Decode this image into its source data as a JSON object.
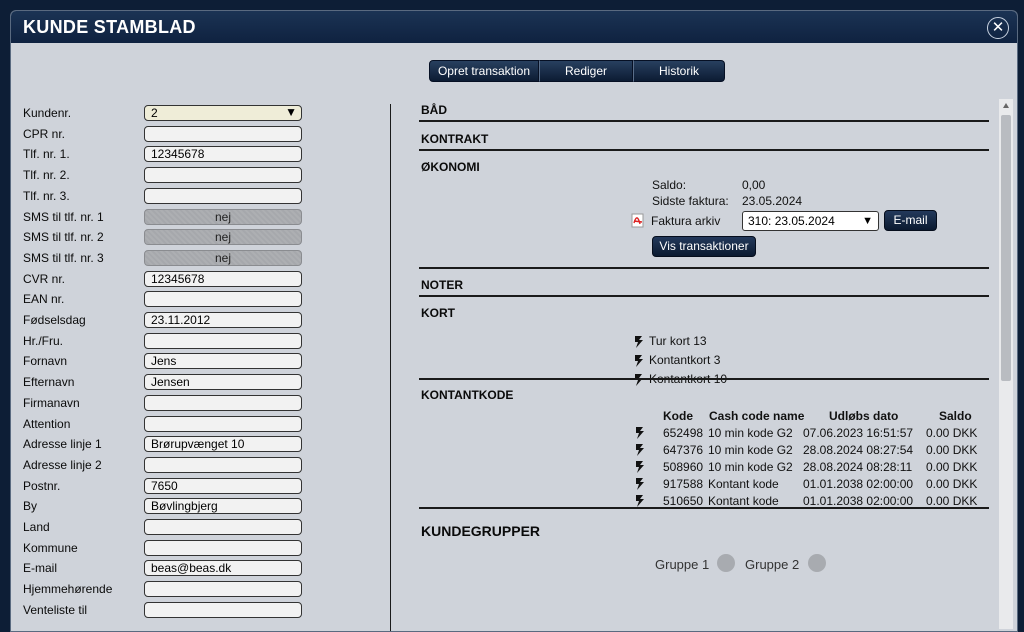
{
  "window": {
    "title": "KUNDE STAMBLAD",
    "close_glyph": "✕"
  },
  "tabs": [
    "Opret transaktion",
    "Rediger",
    "Historik"
  ],
  "fields": [
    {
      "label": "Kundenr.",
      "value": "2",
      "type": "select"
    },
    {
      "label": "CPR nr.",
      "value": ""
    },
    {
      "label": "Tlf. nr. 1.",
      "value": "12345678"
    },
    {
      "label": "Tlf. nr. 2.",
      "value": ""
    },
    {
      "label": "Tlf. nr. 3.",
      "value": ""
    },
    {
      "label": "SMS til tlf. nr. 1",
      "value": "nej",
      "type": "toggle"
    },
    {
      "label": "SMS til tlf. nr. 2",
      "value": "nej",
      "type": "toggle"
    },
    {
      "label": "SMS til tlf. nr. 3",
      "value": "nej",
      "type": "toggle"
    },
    {
      "label": "CVR nr.",
      "value": "12345678"
    },
    {
      "label": "EAN nr.",
      "value": ""
    },
    {
      "label": "Fødselsdag",
      "value": "23.11.2012"
    },
    {
      "label": "Hr./Fru.",
      "value": ""
    },
    {
      "label": "Fornavn",
      "value": "Jens"
    },
    {
      "label": "Efternavn",
      "value": "Jensen"
    },
    {
      "label": "Firmanavn",
      "value": ""
    },
    {
      "label": "Attention",
      "value": ""
    },
    {
      "label": "Adresse linje 1",
      "value": "Brørupvænget 10"
    },
    {
      "label": "Adresse linje 2",
      "value": ""
    },
    {
      "label": "Postnr.",
      "value": "7650"
    },
    {
      "label": "By",
      "value": "Bøvlingbjerg"
    },
    {
      "label": "Land",
      "value": ""
    },
    {
      "label": "Kommune",
      "value": ""
    },
    {
      "label": "E-mail",
      "value": "beas@beas.dk"
    },
    {
      "label": "Hjemmehørende",
      "value": ""
    },
    {
      "label": "Venteliste til",
      "value": ""
    }
  ],
  "sections": {
    "baad": "BÅD",
    "kontrakt": "KONTRAKT",
    "okonomi": "ØKONOMI",
    "noter": "NOTER",
    "kort": "KORT",
    "kontantkode": "KONTANTKODE",
    "kundegrupper": "KUNDEGRUPPER"
  },
  "okonomi": {
    "saldo_label": "Saldo:",
    "saldo_value": "0,00",
    "faktura_label": "Sidste faktura:",
    "faktura_value": "23.05.2024",
    "arkiv_label": "Faktura arkiv",
    "arkiv_selected": "310: 23.05.2024",
    "email_button": "E-mail",
    "vis_button": "Vis transaktioner"
  },
  "kort": [
    "Tur kort 13",
    "Kontantkort 3",
    "Kontantkort 10"
  ],
  "kontantkode": {
    "headers": [
      "Kode",
      "Cash code name",
      "Udløbs dato",
      "Saldo"
    ],
    "rows": [
      [
        "652498",
        "10 min kode G2",
        "07.06.2023 16:51:57",
        "0.00 DKK"
      ],
      [
        "647376",
        "10 min kode G2",
        "28.08.2024 08:27:54",
        "0.00 DKK"
      ],
      [
        "508960",
        "10 min kode G2",
        "28.08.2024 08:28:11",
        "0.00 DKK"
      ],
      [
        "917588",
        "Kontant kode",
        "01.01.2038 02:00:00",
        "0.00 DKK"
      ],
      [
        "510650",
        "Kontant kode",
        "01.01.2038 02:00:00",
        "0.00 DKK"
      ]
    ]
  },
  "kundegrupper": [
    "Gruppe 1",
    "Gruppe 2"
  ],
  "colors": {
    "titlebar": "#0f2240",
    "panel": "#cfd3da",
    "button": "#0b1a30"
  }
}
